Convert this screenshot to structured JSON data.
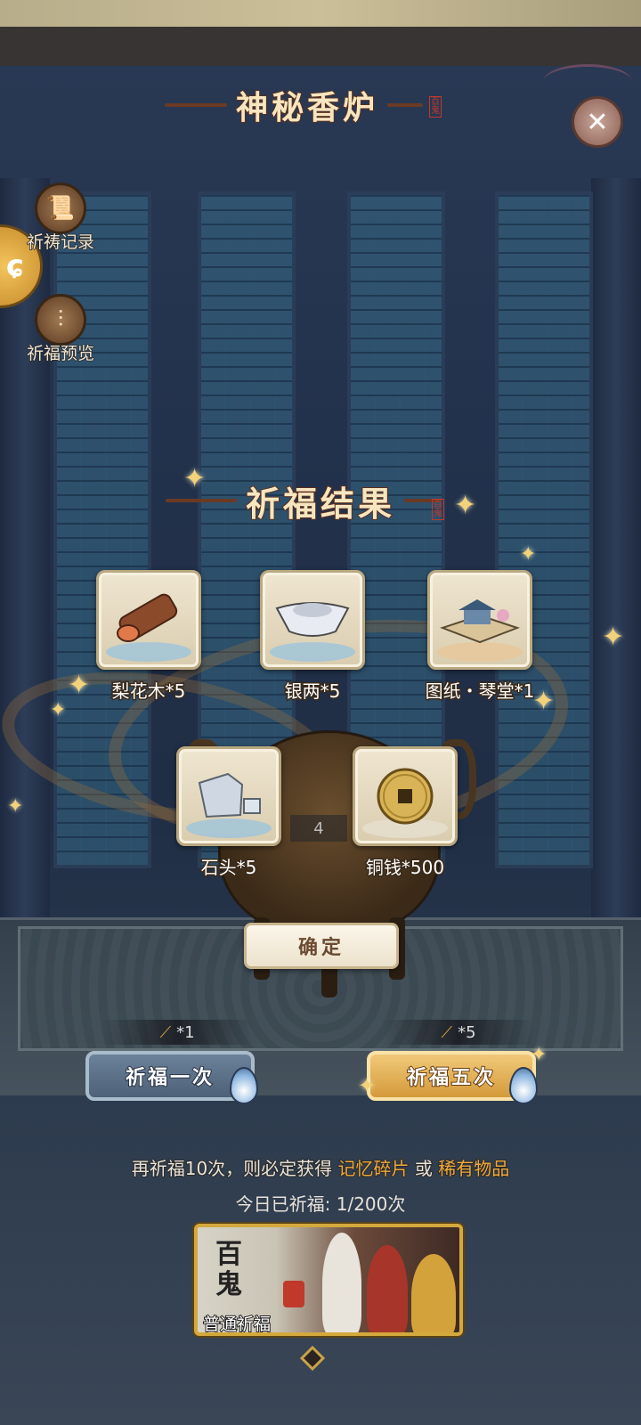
{
  "header": {
    "title": "神秘香炉",
    "stamp": "百鬼"
  },
  "close": {
    "glyph": "✕"
  },
  "side": {
    "records": {
      "label": "祈祷记录",
      "icon": "scroll-icon"
    },
    "preview": {
      "label": "祈福预览",
      "icon": "incense-icon"
    }
  },
  "result": {
    "title": "祈福结果",
    "stamp": "百鬼",
    "items": [
      {
        "name": "梨花木*5",
        "icon": "wood-log-icon"
      },
      {
        "name": "银两*5",
        "icon": "silver-ingot-icon"
      },
      {
        "name": "图纸・琴堂*1",
        "icon": "blueprint-building-icon"
      },
      {
        "name": "石头*5",
        "icon": "stone-block-icon"
      },
      {
        "name": "铜钱*500",
        "icon": "copper-coin-icon"
      }
    ],
    "hidden_count": "4",
    "confirm_label": "确定"
  },
  "pray": {
    "one": {
      "label": "祈福一次",
      "cost": "*1"
    },
    "five": {
      "label": "祈福五次",
      "cost": "*5"
    }
  },
  "hint": {
    "prefix": "再祈福10次，则必定获得",
    "item1": "记忆碎片",
    "or": "或",
    "item2": "稀有物品"
  },
  "today": {
    "label": "今日已祈福:",
    "value": "1/200次"
  },
  "pool": {
    "char": "百鬼",
    "label": "普通祈福"
  },
  "colors": {
    "accent": "#f0a83a",
    "gold_border": "#d4a93c",
    "title_fill": "#f6e6c0"
  }
}
